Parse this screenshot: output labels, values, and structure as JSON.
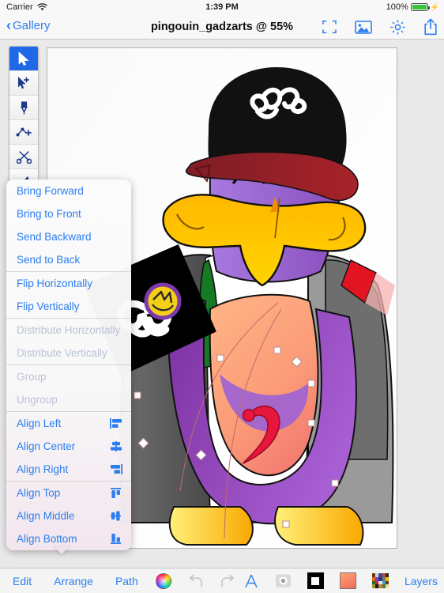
{
  "status_bar": {
    "carrier": "Carrier",
    "wifi_icon": "wifi-icon",
    "time": "1:39 PM",
    "battery_percent": "100%",
    "battery_icon": "battery-full-icon",
    "charging_icon": "lightning-bolt-icon"
  },
  "nav_bar": {
    "back_label": "Gallery",
    "back_chevron": "chevron-left-icon",
    "title": "pingouin_gadzarts @ 55%",
    "actions": [
      {
        "name": "fit-to-screen-icon",
        "label": "Fit to Screen"
      },
      {
        "name": "image-icon",
        "label": "Image"
      },
      {
        "name": "gear-icon",
        "label": "Settings"
      },
      {
        "name": "share-icon",
        "label": "Share"
      }
    ]
  },
  "tool_palette": {
    "tools": [
      {
        "name": "select-tool",
        "label": "Select",
        "selected": true
      },
      {
        "name": "add-select-tool",
        "label": "Add to Selection",
        "selected": false
      },
      {
        "name": "pen-tool",
        "label": "Pen",
        "selected": false
      },
      {
        "name": "add-node-tool",
        "label": "Add Node",
        "selected": false
      },
      {
        "name": "scissors-tool",
        "label": "Scissors",
        "selected": false
      },
      {
        "name": "brush-tool",
        "label": "Brush",
        "selected": false
      }
    ]
  },
  "arrange_menu": {
    "groups": [
      {
        "items": [
          {
            "label": "Bring Forward",
            "name": "menu-bring-forward",
            "disabled": false,
            "icon": ""
          },
          {
            "label": "Bring to Front",
            "name": "menu-bring-to-front",
            "disabled": false,
            "icon": ""
          },
          {
            "label": "Send Backward",
            "name": "menu-send-backward",
            "disabled": false,
            "icon": ""
          },
          {
            "label": "Send to Back",
            "name": "menu-send-to-back",
            "disabled": false,
            "icon": ""
          }
        ]
      },
      {
        "items": [
          {
            "label": "Flip Horizontally",
            "name": "menu-flip-horizontally",
            "disabled": false,
            "icon": ""
          },
          {
            "label": "Flip Vertically",
            "name": "menu-flip-vertically",
            "disabled": false,
            "icon": ""
          }
        ]
      },
      {
        "items": [
          {
            "label": "Distribute Horizontally",
            "name": "menu-distribute-horizontally",
            "disabled": true,
            "icon": ""
          },
          {
            "label": "Distribute Vertically",
            "name": "menu-distribute-vertically",
            "disabled": true,
            "icon": ""
          }
        ]
      },
      {
        "items": [
          {
            "label": "Group",
            "name": "menu-group",
            "disabled": true,
            "icon": ""
          },
          {
            "label": "Ungroup",
            "name": "menu-ungroup",
            "disabled": true,
            "icon": ""
          }
        ]
      },
      {
        "items": [
          {
            "label": "Align Left",
            "name": "menu-align-left",
            "disabled": false,
            "icon": "align-left-icon"
          },
          {
            "label": "Align Center",
            "name": "menu-align-center",
            "disabled": false,
            "icon": "align-center-icon"
          },
          {
            "label": "Align Right",
            "name": "menu-align-right",
            "disabled": false,
            "icon": "align-right-icon"
          }
        ]
      },
      {
        "items": [
          {
            "label": "Align Top",
            "name": "menu-align-top",
            "disabled": false,
            "icon": "align-top-icon"
          },
          {
            "label": "Align Middle",
            "name": "menu-align-middle",
            "disabled": false,
            "icon": "align-middle-icon"
          },
          {
            "label": "Align Bottom",
            "name": "menu-align-bottom",
            "disabled": false,
            "icon": "align-bottom-icon"
          }
        ]
      }
    ]
  },
  "bottom_bar": {
    "edit_label": "Edit",
    "arrange_label": "Arrange",
    "path_label": "Path",
    "layers_label": "Layers",
    "color_wheel_icon": "color-wheel-icon",
    "undo_icon": "undo-icon",
    "redo_icon": "redo-icon",
    "text-icon": "text-style-icon",
    "camera_icon": "camera-icon",
    "stroke_swatch_icon": "stroke-color-swatch",
    "fill_swatch_icon": "fill-color-swatch",
    "palette_icon": "palette-swatches-icon"
  },
  "canvas": {
    "zoom_level": "55%",
    "document_name": "pingouin_gadzarts",
    "artwork_description": "penguin-illustration"
  },
  "colors": {
    "accent_blue": "#2b7ef0",
    "selected_tool_blue": "#1f68e8",
    "disabled_gray": "#b9c3d4",
    "bar_background": "#f4f4f4",
    "workspace_gray": "#e9e9e9",
    "battery_green": "#3ac13a"
  }
}
